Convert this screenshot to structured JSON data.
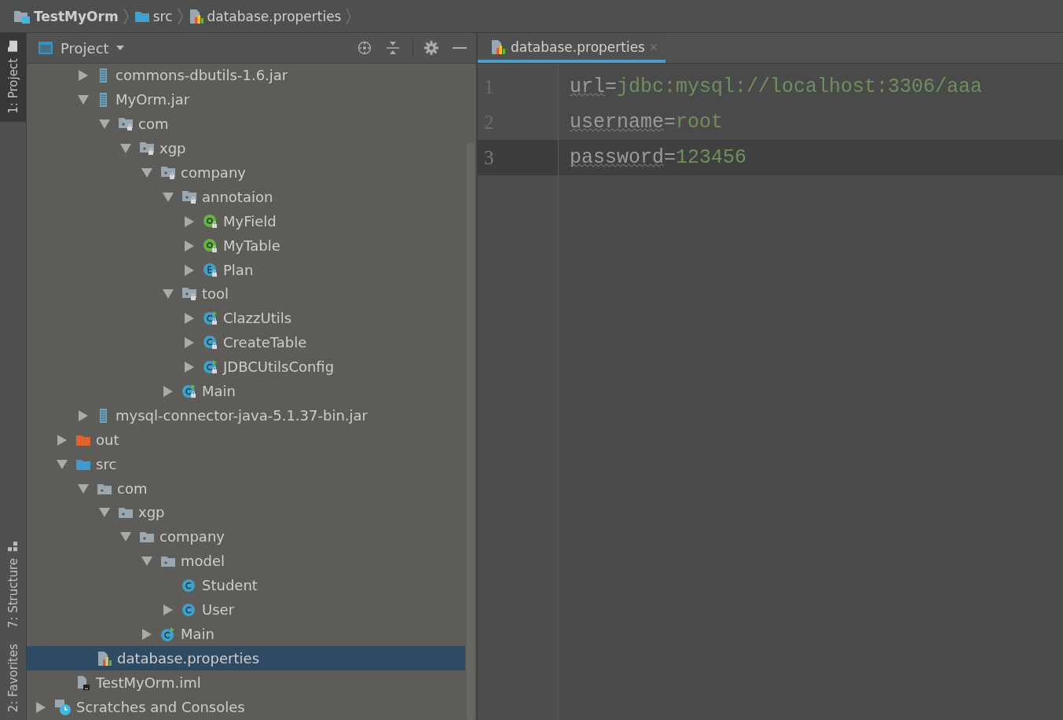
{
  "breadcrumbs": [
    {
      "label": "TestMyOrm",
      "kind": "project"
    },
    {
      "label": "src",
      "kind": "folder"
    },
    {
      "label": "database.properties",
      "kind": "properties"
    }
  ],
  "tool_strip": {
    "top": [
      {
        "label": "1: Project",
        "selected": true,
        "kind": "folder"
      }
    ],
    "bottom": [
      {
        "label": "7: Structure",
        "selected": false,
        "kind": "structure"
      },
      {
        "label": "2: Favorites",
        "selected": false,
        "kind": "none"
      }
    ]
  },
  "project_panel": {
    "title": "Project",
    "tree": [
      {
        "children": [
          {
            "children": [
              {
                "label": "commons-dbutils-1.6.jar",
                "kind": "jar",
                "expanded": false
              },
              {
                "label": "MyOrm.jar",
                "kind": "jar",
                "expanded": true,
                "children": [
                  {
                    "label": "com",
                    "kind": "package-lib",
                    "expanded": true,
                    "children": [
                      {
                        "label": "xgp",
                        "kind": "package-lib",
                        "expanded": true,
                        "children": [
                          {
                            "label": "company",
                            "kind": "package-lib",
                            "expanded": true,
                            "children": [
                              {
                                "label": "annotaion",
                                "kind": "package-lib",
                                "expanded": true,
                                "children": [
                                  {
                                    "label": "MyField",
                                    "kind": "annotation",
                                    "expanded": false
                                  },
                                  {
                                    "label": "MyTable",
                                    "kind": "annotation",
                                    "expanded": false
                                  },
                                  {
                                    "label": "Plan",
                                    "kind": "enum",
                                    "expanded": false
                                  }
                                ]
                              },
                              {
                                "label": "tool",
                                "kind": "package-lib",
                                "expanded": true,
                                "children": [
                                  {
                                    "label": "ClazzUtils",
                                    "kind": "class-main-lib",
                                    "expanded": false
                                  },
                                  {
                                    "label": "CreateTable",
                                    "kind": "class-lib",
                                    "expanded": false
                                  },
                                  {
                                    "label": "JDBCUtilsConfig",
                                    "kind": "class-main-lib",
                                    "expanded": false
                                  }
                                ]
                              },
                              {
                                "label": "Main",
                                "kind": "class-main-lib",
                                "expanded": false
                              }
                            ]
                          }
                        ]
                      }
                    ]
                  }
                ]
              },
              {
                "label": "mysql-connector-java-5.1.37-bin.jar",
                "kind": "jar",
                "expanded": false
              }
            ]
          },
          {
            "label": "out",
            "kind": "folder-excluded",
            "expanded": false
          },
          {
            "label": "src",
            "kind": "folder-source",
            "expanded": true,
            "children": [
              {
                "label": "com",
                "kind": "package",
                "expanded": true,
                "children": [
                  {
                    "label": "xgp",
                    "kind": "package",
                    "expanded": true,
                    "children": [
                      {
                        "label": "company",
                        "kind": "package",
                        "expanded": true,
                        "children": [
                          {
                            "label": "model",
                            "kind": "package",
                            "expanded": true,
                            "children": [
                              {
                                "label": "Student",
                                "kind": "class"
                              },
                              {
                                "label": "User",
                                "kind": "class",
                                "expanded": false
                              }
                            ]
                          },
                          {
                            "label": "Main",
                            "kind": "class-main",
                            "expanded": false
                          }
                        ]
                      }
                    ]
                  }
                ]
              },
              {
                "label": "database.properties",
                "kind": "properties",
                "selected": true
              }
            ]
          },
          {
            "label": "TestMyOrm.iml",
            "kind": "iml"
          }
        ]
      },
      {
        "label": "Scratches and Consoles",
        "kind": "scratches",
        "expanded": false
      }
    ]
  },
  "editor": {
    "tabs": [
      {
        "label": "database.properties",
        "kind": "properties",
        "selected": true
      }
    ],
    "lines": [
      {
        "number": "1",
        "key": "url",
        "operator": "=",
        "value": "jdbc:mysql://localhost:3306/aaa",
        "current": false
      },
      {
        "number": "2",
        "key": "username",
        "operator": "=",
        "value": "root",
        "current": false
      },
      {
        "number": "3",
        "key": "password",
        "operator": "=",
        "value": "123456",
        "current": true
      }
    ]
  }
}
